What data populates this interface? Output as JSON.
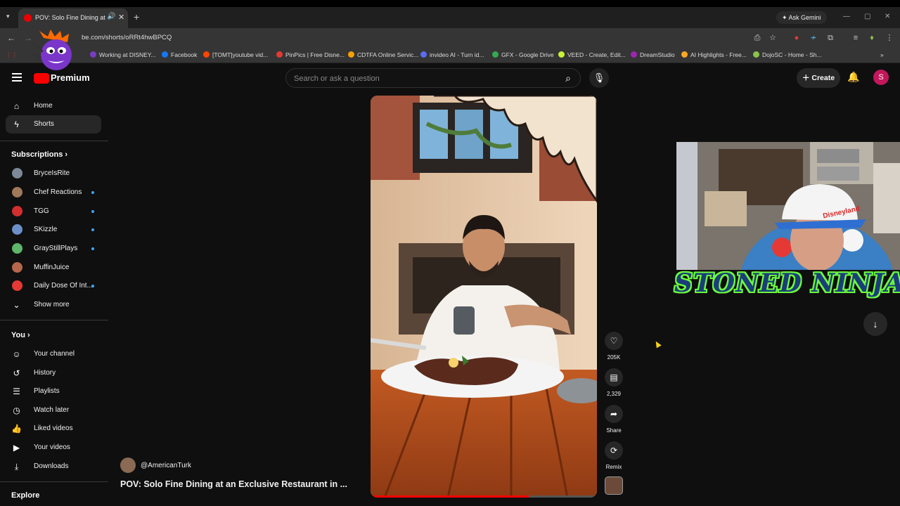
{
  "browser": {
    "tab_title": "POV: Solo Fine Dining at an Exclusive Restaurant",
    "new_tab": "+",
    "gemini": "Ask Gemini",
    "url": "be.com/shorts/oRRt4hwBPCQ",
    "bookmarks": [
      {
        "label": "Working at DISNEY...",
        "color": "#7a3cc4"
      },
      {
        "label": "Facebook",
        "color": "#1877f2"
      },
      {
        "label": "[TOMT]youtube vid...",
        "color": "#ff4500"
      },
      {
        "label": "PinPics | Free Disne...",
        "color": "#e53935"
      },
      {
        "label": "CDTFA Online Servic...",
        "color": "#f4a100"
      },
      {
        "label": "invideo AI - Turn id...",
        "color": "#5b6cf0"
      },
      {
        "label": "GFX - Google Drive",
        "color": "#34a853"
      },
      {
        "label": "VEED - Create, Edit...",
        "color": "#c6f432"
      },
      {
        "label": "DreamStudio",
        "color": "#9c27b0"
      },
      {
        "label": "AI Highlights - Free...",
        "color": "#f9a825"
      },
      {
        "label": "DojoSC - Home - Sh...",
        "color": "#8bc34a"
      }
    ]
  },
  "header": {
    "logo_text": "Premium",
    "search_placeholder": "Search or ask a question",
    "create_label": "Create",
    "avatar_letter": "S"
  },
  "sidebar": {
    "main": [
      {
        "label": "Home",
        "icon": "home-icon"
      },
      {
        "label": "Shorts",
        "icon": "shorts-icon"
      }
    ],
    "subscriptions_heading": "Subscriptions",
    "subscriptions": [
      {
        "label": "BryceIsRite",
        "color": "#7b8a96",
        "dot": false
      },
      {
        "label": "Chef Reactions",
        "color": "#a0785a",
        "dot": true
      },
      {
        "label": "TGG",
        "color": "#d32f2f",
        "dot": true
      },
      {
        "label": "SKizzle",
        "color": "#6d8fc7",
        "dot": true
      },
      {
        "label": "GrayStillPlays",
        "color": "#5fb66a",
        "dot": true
      },
      {
        "label": "MuffinJuice",
        "color": "#b5674d",
        "dot": false
      },
      {
        "label": "Daily Dose Of Int...",
        "color": "#e53935",
        "dot": true
      }
    ],
    "show_more": "Show more",
    "you_heading": "You",
    "you": [
      {
        "label": "Your channel",
        "icon": "channel-icon"
      },
      {
        "label": "History",
        "icon": "history-icon"
      },
      {
        "label": "Playlists",
        "icon": "playlists-icon"
      },
      {
        "label": "Watch later",
        "icon": "watch-later-icon"
      },
      {
        "label": "Liked videos",
        "icon": "liked-icon"
      },
      {
        "label": "Your videos",
        "icon": "your-videos-icon"
      },
      {
        "label": "Downloads",
        "icon": "downloads-icon"
      }
    ],
    "explore_heading": "Explore"
  },
  "short": {
    "likes": "205K",
    "comments": "2,329",
    "share": "Share",
    "remix": "Remix",
    "channel": "@AmericanTurk",
    "title": "POV: Solo Fine Dining at an Exclusive Restaurant in ...",
    "progress": 0.7
  },
  "overlay": {
    "webcam_hat_text": "Disneyland",
    "stream_name": "STONED NINJA"
  }
}
